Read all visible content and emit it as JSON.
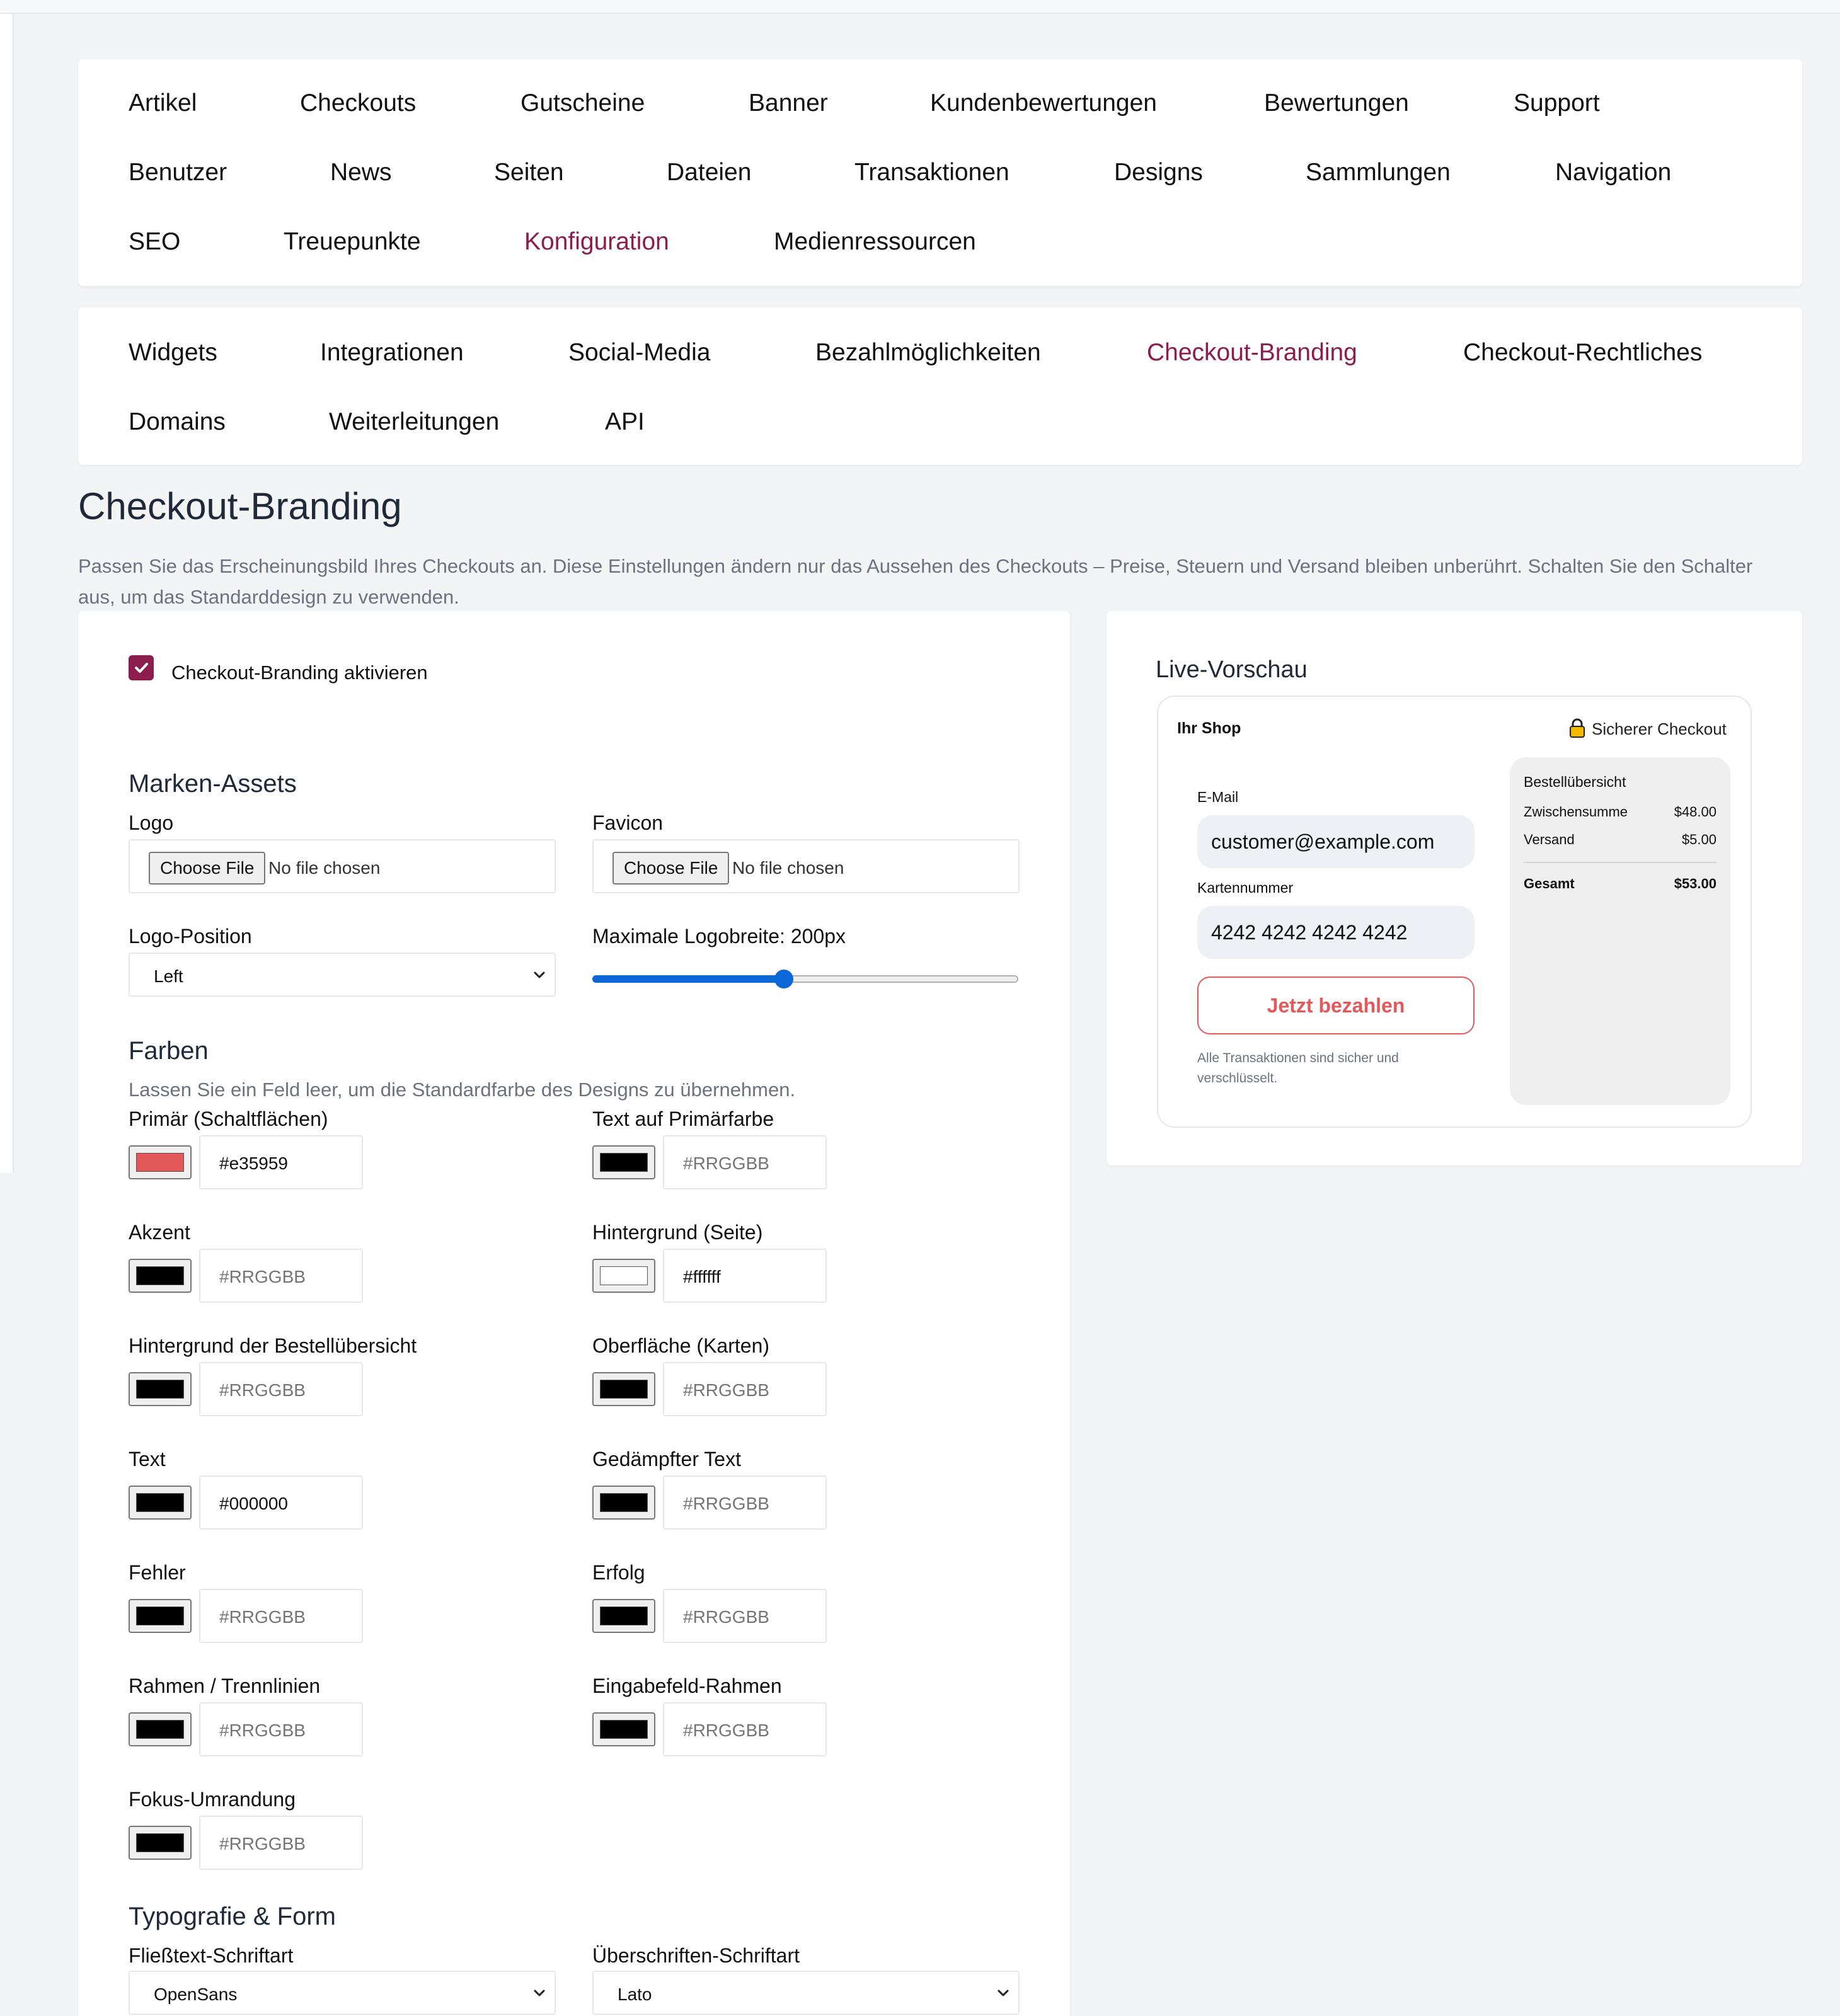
{
  "main_nav": {
    "items": [
      {
        "label": "Artikel",
        "active": false
      },
      {
        "label": "Checkouts",
        "active": false
      },
      {
        "label": "Gutscheine",
        "active": false
      },
      {
        "label": "Banner",
        "active": false
      },
      {
        "label": "Kundenbewertungen",
        "active": false
      },
      {
        "label": "Bewertungen",
        "active": false
      },
      {
        "label": "Support",
        "active": false
      },
      {
        "label": "Benutzer",
        "active": false
      },
      {
        "label": "News",
        "active": false
      },
      {
        "label": "Seiten",
        "active": false
      },
      {
        "label": "Dateien",
        "active": false
      },
      {
        "label": "Transaktionen",
        "active": false
      },
      {
        "label": "Designs",
        "active": false
      },
      {
        "label": "Sammlungen",
        "active": false
      },
      {
        "label": "Navigation",
        "active": false
      },
      {
        "label": "SEO",
        "active": false
      },
      {
        "label": "Treuepunkte",
        "active": false
      },
      {
        "label": "Konfiguration",
        "active": true
      },
      {
        "label": "Medienressourcen",
        "active": false
      }
    ]
  },
  "sub_nav": {
    "items": [
      {
        "label": "Widgets",
        "active": false
      },
      {
        "label": "Integrationen",
        "active": false
      },
      {
        "label": "Social-Media",
        "active": false
      },
      {
        "label": "Bezahlmöglichkeiten",
        "active": false
      },
      {
        "label": "Checkout-Branding",
        "active": true
      },
      {
        "label": "Checkout-Rechtliches",
        "active": false
      },
      {
        "label": "Domains",
        "active": false
      },
      {
        "label": "Weiterleitungen",
        "active": false
      },
      {
        "label": "API",
        "active": false
      }
    ]
  },
  "page": {
    "title": "Checkout-Branding",
    "description": "Passen Sie das Erscheinungsbild Ihres Checkouts an. Diese Einstellungen ändern nur das Aussehen des Checkouts – Preise, Steuern und Versand bleiben unberührt. Schalten Sie den Schalter aus, um das Standarddesign zu verwenden."
  },
  "form": {
    "enable_label": "Checkout-Branding aktivieren",
    "enabled": true,
    "brand_assets": {
      "heading": "Marken-Assets",
      "logo_label": "Logo",
      "favicon_label": "Favicon",
      "choose_file": "Choose File",
      "no_file": "No file chosen",
      "logo_position_label": "Logo-Position",
      "logo_position_value": "Left",
      "max_width_label": "Maximale Logobreite: 200px",
      "max_width_fraction": 0.45
    },
    "colors": {
      "heading": "Farben",
      "hint": "Lassen Sie ein Feld leer, um die Standardfarbe des Designs zu übernehmen.",
      "placeholder": "#RRGGBB",
      "fields": [
        {
          "label": "Primär (Schaltflächen)",
          "value": "#e35959",
          "swatch": "#e35959"
        },
        {
          "label": "Text auf Primärfarbe",
          "value": "",
          "swatch": "#000000"
        },
        {
          "label": "Akzent",
          "value": "",
          "swatch": "#000000"
        },
        {
          "label": "Hintergrund (Seite)",
          "value": "#ffffff",
          "swatch": "#ffffff"
        },
        {
          "label": "Hintergrund der Bestellübersicht",
          "value": "",
          "swatch": "#000000"
        },
        {
          "label": "Oberfläche (Karten)",
          "value": "",
          "swatch": "#000000"
        },
        {
          "label": "Text",
          "value": "#000000",
          "swatch": "#000000"
        },
        {
          "label": "Gedämpfter Text",
          "value": "",
          "swatch": "#000000"
        },
        {
          "label": "Fehler",
          "value": "",
          "swatch": "#000000"
        },
        {
          "label": "Erfolg",
          "value": "",
          "swatch": "#000000"
        },
        {
          "label": "Rahmen / Trennlinien",
          "value": "",
          "swatch": "#000000"
        },
        {
          "label": "Eingabefeld-Rahmen",
          "value": "",
          "swatch": "#000000"
        },
        {
          "label": "Fokus-Umrandung",
          "value": "",
          "swatch": "#000000"
        }
      ]
    },
    "typography": {
      "heading": "Typografie & Form",
      "body_font_label": "Fließtext-Schriftart",
      "body_font_value": "OpenSans",
      "heading_font_label": "Überschriften-Schriftart",
      "heading_font_value": "Lato"
    }
  },
  "preview": {
    "heading": "Live-Vorschau",
    "shop_name": "Ihr Shop",
    "secure_label": "Sicherer Checkout",
    "email_label": "E-Mail",
    "email_value": "customer@example.com",
    "card_label": "Kartennummer",
    "card_value": "4242 4242 4242 4242",
    "pay_button": "Jetzt bezahlen",
    "secure_note": "Alle Transaktionen sind sicher und verschlüsselt.",
    "summary": {
      "title": "Bestellübersicht",
      "subtotal_label": "Zwischensumme",
      "subtotal_value": "$48.00",
      "shipping_label": "Versand",
      "shipping_value": "$5.00",
      "total_label": "Gesamt",
      "total_value": "$53.00"
    },
    "accent": "#e35959",
    "lock_icon": "lock-icon"
  }
}
